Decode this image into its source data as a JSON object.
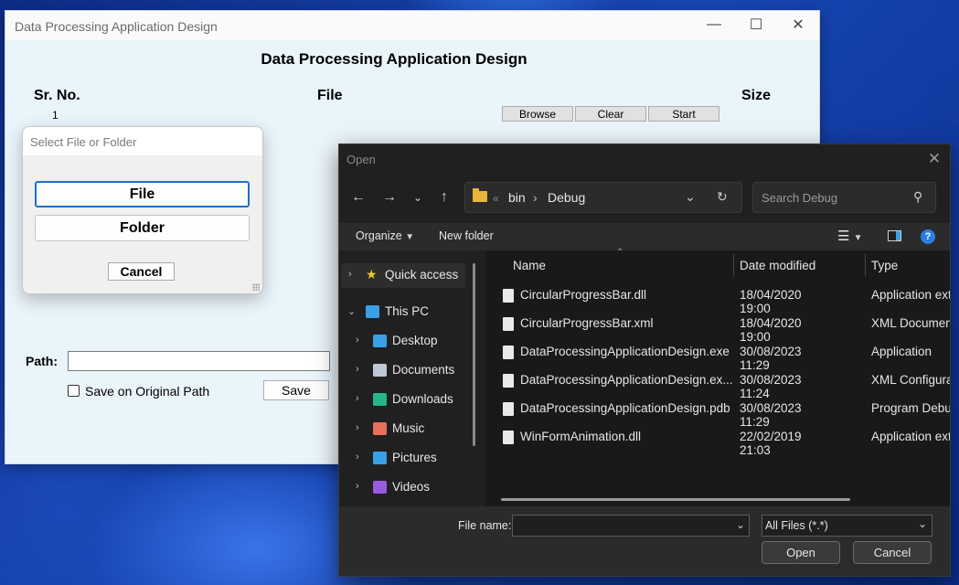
{
  "main_window": {
    "title": "Data Processing Application Design",
    "heading": "Data Processing Application Design",
    "columns": {
      "sr_no": "Sr. No.",
      "file": "File",
      "size": "Size"
    },
    "row_number": "1",
    "buttons": {
      "browse": "Browse",
      "clear": "Clear",
      "start": "Start",
      "save": "Save"
    },
    "path_label": "Path:",
    "path_value": "",
    "save_original_label": "Save on Original Path",
    "save_original_checked": false
  },
  "select_dialog": {
    "title": "Select File or Folder",
    "file_button": "File",
    "folder_button": "Folder",
    "cancel_button": "Cancel"
  },
  "open_dialog": {
    "title": "Open",
    "breadcrumb": {
      "prefix": "«",
      "items": [
        "bin",
        "Debug"
      ]
    },
    "search_placeholder": "Search Debug",
    "toolbar": {
      "organize": "Organize",
      "new_folder": "New folder"
    },
    "nav": {
      "quick_access": "Quick access",
      "this_pc": "This PC",
      "items": [
        {
          "label": "Desktop",
          "icon": "desktop-icon",
          "color": "#3aa0e8"
        },
        {
          "label": "Documents",
          "icon": "documents-icon",
          "color": "#bfc7d5"
        },
        {
          "label": "Downloads",
          "icon": "downloads-icon",
          "color": "#27b58a"
        },
        {
          "label": "Music",
          "icon": "music-icon",
          "color": "#e8705a"
        },
        {
          "label": "Pictures",
          "icon": "pictures-icon",
          "color": "#3aa0e8"
        },
        {
          "label": "Videos",
          "icon": "videos-icon",
          "color": "#9a5ae0"
        }
      ]
    },
    "columns": {
      "name": "Name",
      "date": "Date modified",
      "type": "Type"
    },
    "files": [
      {
        "name": "CircularProgressBar.dll",
        "date": "18/04/2020 19:00",
        "type": "Application ext"
      },
      {
        "name": "CircularProgressBar.xml",
        "date": "18/04/2020 19:00",
        "type": "XML Documen"
      },
      {
        "name": "DataProcessingApplicationDesign.exe",
        "date": "30/08/2023 11:29",
        "type": "Application"
      },
      {
        "name": "DataProcessingApplicationDesign.ex...",
        "date": "30/08/2023 11:24",
        "type": "XML Configura"
      },
      {
        "name": "DataProcessingApplicationDesign.pdb",
        "date": "30/08/2023 11:29",
        "type": "Program Debu"
      },
      {
        "name": "WinFormAnimation.dll",
        "date": "22/02/2019 21:03",
        "type": "Application ext"
      }
    ],
    "file_name_label": "File name:",
    "file_name_value": "",
    "filter_value": "All Files (*.*)",
    "open_button": "Open",
    "cancel_button": "Cancel"
  }
}
